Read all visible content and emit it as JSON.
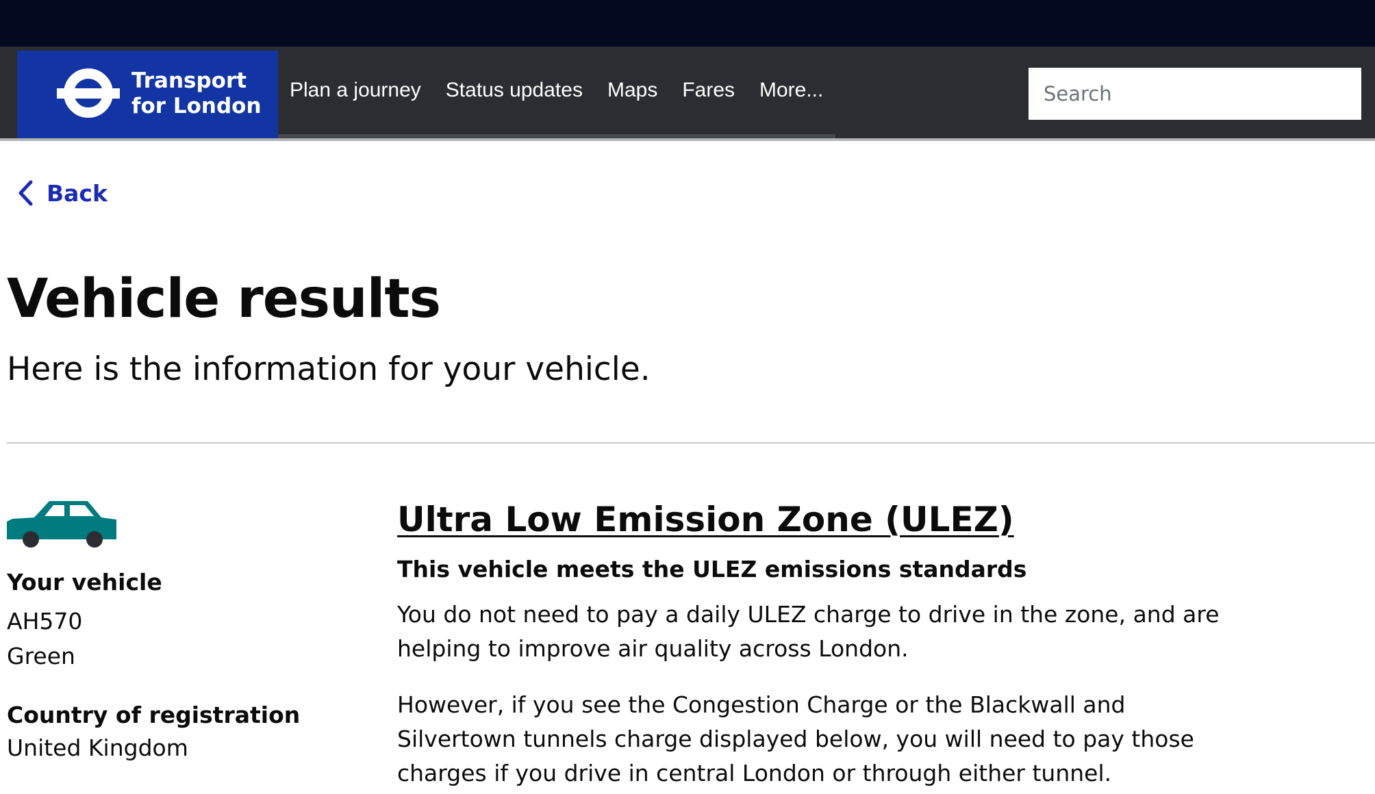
{
  "header": {
    "logo_line1": "Transport",
    "logo_line2": "for London",
    "nav": [
      "Plan a journey",
      "Status updates",
      "Maps",
      "Fares",
      "More..."
    ],
    "search_placeholder": "Search"
  },
  "back_label": "Back",
  "page": {
    "title": "Vehicle results",
    "lead": "Here is the information for your vehicle."
  },
  "vehicle": {
    "icon": "car-icon",
    "icon_color": "#007c80",
    "heading": "Your vehicle",
    "registration": "AH570",
    "colour": "Green",
    "country_heading": "Country of registration",
    "country": "United Kingdom"
  },
  "ulez": {
    "title": "Ultra Low Emission Zone (ULEZ)",
    "status": "This vehicle meets the ULEZ emissions standards",
    "para1": "You do not need to pay a daily ULEZ charge to drive in the zone, and are helping to improve air quality across London.",
    "para2": "However, if you see the Congestion Charge or the Blackwall and Silvertown tunnels charge displayed below, you will need to pay those charges if you drive in central London or through either tunnel."
  },
  "colors": {
    "topbar": "#030a20",
    "navbar": "#2b2d33",
    "logo_bg": "#1335a3",
    "link": "#1d2bb3"
  }
}
